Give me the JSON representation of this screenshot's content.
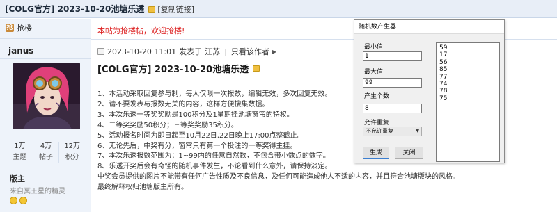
{
  "topbar": {
    "title": "[COLG官方] 2023-10-20池塘乐透",
    "copy_link": "[复制链接]"
  },
  "sidebar": {
    "reply_label": "抢楼",
    "username": "janus",
    "stats": [
      {
        "num": "1万",
        "label": "主题"
      },
      {
        "num": "4万",
        "label": "帖子"
      },
      {
        "num": "12万",
        "label": "积分"
      }
    ],
    "role": "版主",
    "group": "来自冥王星的精灵"
  },
  "post": {
    "notice": "本帖为抢楼帖，欢迎抢楼!",
    "meta": {
      "date": "2023-10-20 11:01",
      "posted_from": "发表于",
      "location": "江苏",
      "view_author": "只看该作者"
    },
    "title": "[COLG官方] 2023-10-20池塘乐透",
    "lines": [
      "1、本活动采取回复参与制，每人仅限一次报数，编辑无效，多次回复无效。",
      "2、请不要发表与报数无关的内容，这样方便搜集数据。",
      "3、本次乐透一等奖奖励是100积分及1星期挂池塘窗帘的特权。",
      "4、二等奖奖励50积分；三等奖奖励35积分。",
      "5、活动报名时间为即日起至10月22日,22日晚上17:00点整截止。",
      "6、无论先后，中奖有分，窗帘只有第一个投注的一等奖得主挂。",
      "7、本次乐透报数范围为：1~99内的任意自然数，不包含带小数点的数字。",
      "8、乐透开奖后会有奇怪的随机事件发生，不论看到什么意外，请保持淡定。",
      "中奖会员提供的图片不能带有任何广告性质及不良信息，及任何可能造成他人不适的内容，并且符合池塘版块的风格。",
      "最终解释权归池塘版主所有。"
    ]
  },
  "dialog": {
    "title": "随机数产生器",
    "min_label": "最小值",
    "min_value": "1",
    "max_label": "最大值",
    "max_value": "99",
    "count_label": "产生个数",
    "count_value": "8",
    "repeat_label": "允许重复",
    "repeat_value": "不允许重复",
    "generate_label": "生成",
    "close_label": "关闭",
    "results": [
      "59",
      "17",
      "56",
      "85",
      "77",
      "74",
      "78",
      "75"
    ]
  },
  "colors": {
    "notice_red": "#dd2222",
    "topbar_bg": "#e8eef7",
    "sidebar_bg": "#eef3fa",
    "lock_gold": "#f0c040"
  }
}
